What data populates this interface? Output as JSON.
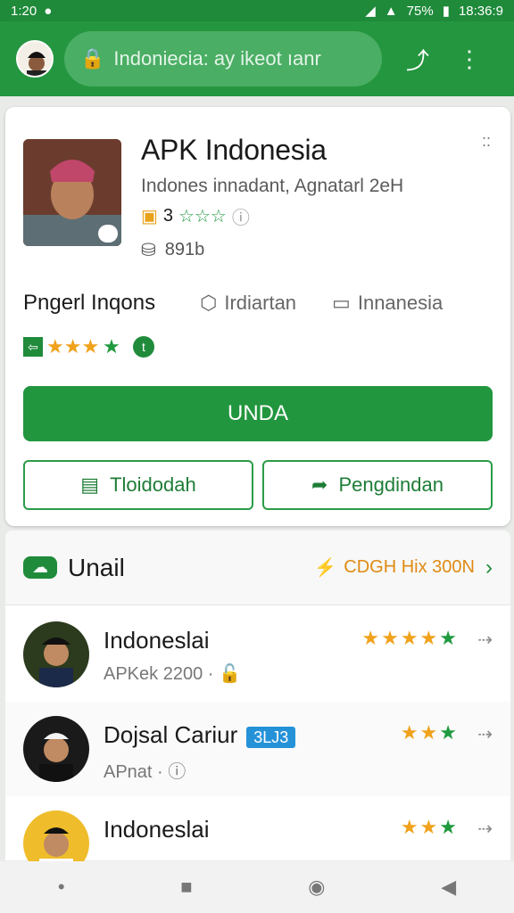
{
  "status": {
    "time": "1:20",
    "battery": "75%",
    "clock": "18:36:9"
  },
  "browser": {
    "url": "Indoniecia: ay ikeot ıanr"
  },
  "app": {
    "title": "APK Indonesia",
    "subtitle": "Indones innadant, Agnatarl 2eH",
    "rating": "3",
    "size": "891b",
    "meta": {
      "left": "Pngerl Inqons",
      "loc": "Irdiartan",
      "lang": "Innanesia"
    },
    "primary_button": "UNDA",
    "btn_left": "Tloidodah",
    "btn_right": "Pengdindan"
  },
  "list": {
    "title": "Unail",
    "promo": "CDGH Hix 300N",
    "items": [
      {
        "name": "Indoneslai",
        "sub": "APKek 2200 ·",
        "stars": 5,
        "tag": ""
      },
      {
        "name": "Dojsal Cariur",
        "sub": "APnat ·",
        "stars": 3,
        "tag": "3LJ3"
      },
      {
        "name": "Indoneslai",
        "sub": "",
        "stars": 3,
        "tag": ""
      }
    ]
  },
  "colors": {
    "brand": "#24963f",
    "star": "#f0a21c",
    "tag": "#2592d8"
  }
}
